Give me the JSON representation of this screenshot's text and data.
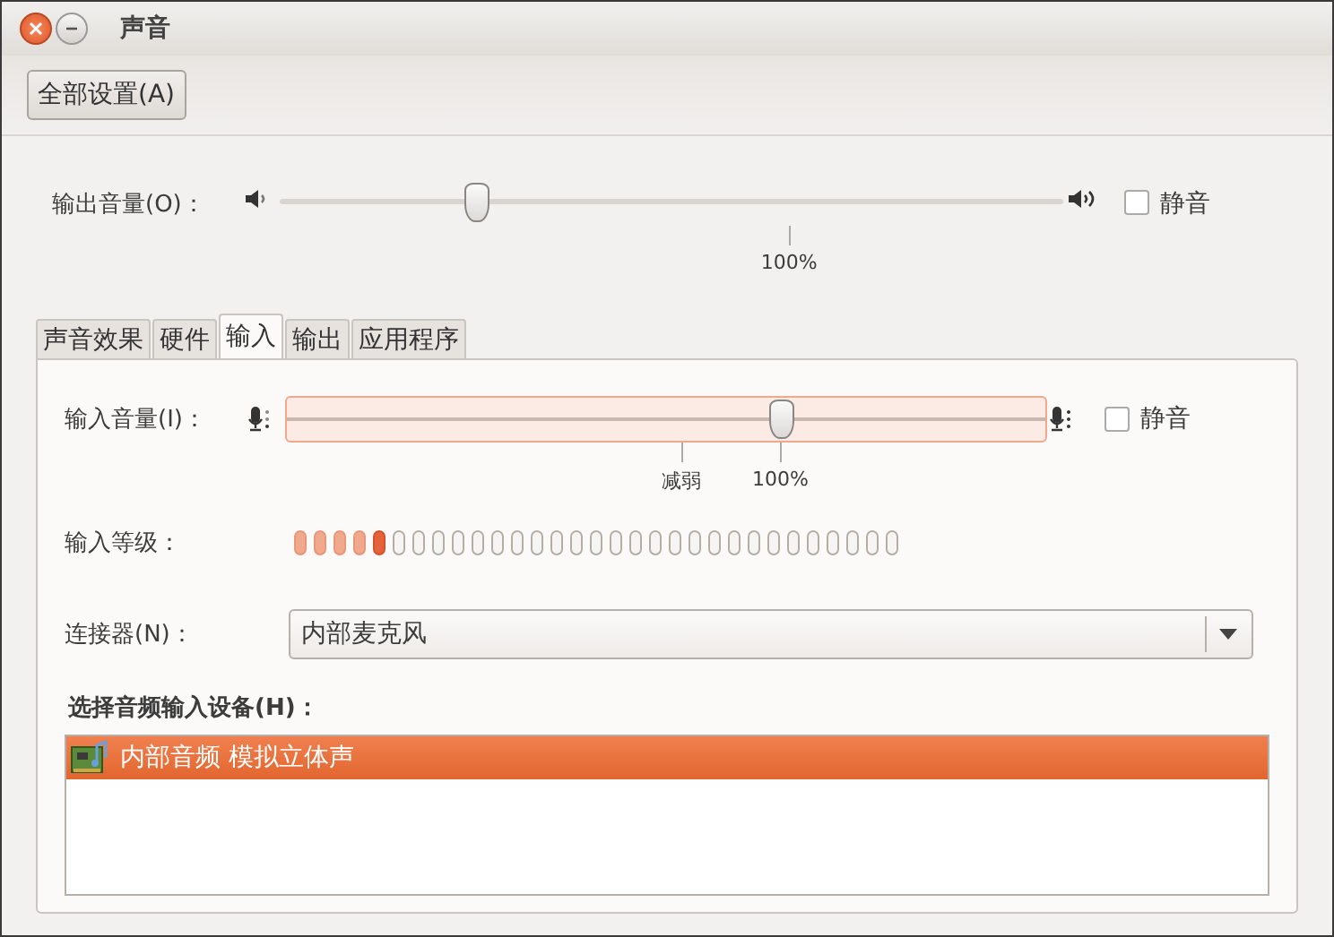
{
  "window": {
    "title": "声音"
  },
  "toolbar": {
    "button": "全部设置(A)"
  },
  "output": {
    "label": "输出音量(O)：",
    "level": 0.25,
    "marks": [
      {
        "label": "100%",
        "level": 0.65
      }
    ],
    "mute": {
      "label": "静音",
      "checked": false
    }
  },
  "tabs": [
    {
      "label": "声音效果",
      "selected": false
    },
    {
      "label": "硬件",
      "selected": false
    },
    {
      "label": "输入",
      "selected": true
    },
    {
      "label": "输出",
      "selected": false
    },
    {
      "label": "应用程序",
      "selected": false
    }
  ],
  "input": {
    "label": "输入音量(I)：",
    "level": 0.65,
    "marks": [
      {
        "label": "减弱",
        "level": 0.52
      },
      {
        "label": "100%",
        "level": 0.65
      }
    ],
    "mute": {
      "label": "静音",
      "checked": false
    }
  },
  "input_level": {
    "label": "输入等级：",
    "level": 0.16
  },
  "connector": {
    "label": "连接器(N)：",
    "value": "内部麦克风"
  },
  "devices": {
    "heading": "选择音频输入设备(H)：",
    "items": [
      {
        "name": "内部音频 模拟立体声",
        "selected": true
      }
    ]
  }
}
